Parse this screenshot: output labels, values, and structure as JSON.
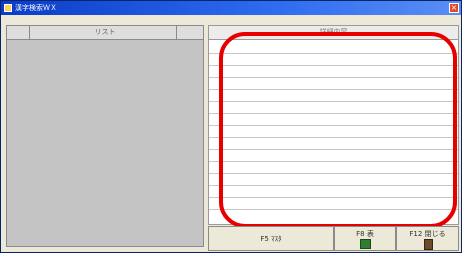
{
  "window": {
    "title": "漢字検索ＷＸ"
  },
  "left_panel": {
    "header": "リスト"
  },
  "right_panel": {
    "header": "詳細内容"
  },
  "buttons": [
    {
      "label": "F5 ﾏｽﾀ",
      "icon": ""
    },
    {
      "label": "F8 表",
      "icon": "grid-icon"
    },
    {
      "label": "F12 閉じる",
      "icon": "door-exit-icon"
    }
  ]
}
